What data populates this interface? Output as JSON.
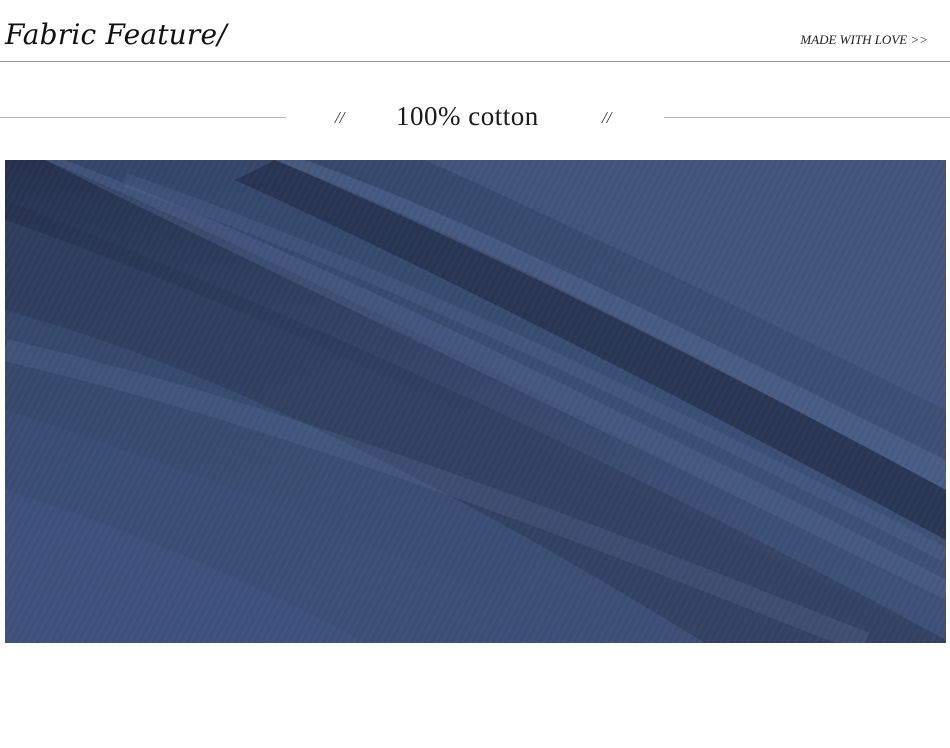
{
  "header": {
    "title": "Fabric Feature/",
    "tagline": "MADE WITH LOVE >>"
  },
  "section": {
    "heading": "100% cotton",
    "left_mark": "//",
    "right_mark": "//"
  },
  "photo": {
    "subject": "fabric-swatch",
    "colors": {
      "base": "#3b4d72",
      "shadow": "#1f2a45",
      "highlight": "#5a6d95"
    }
  }
}
